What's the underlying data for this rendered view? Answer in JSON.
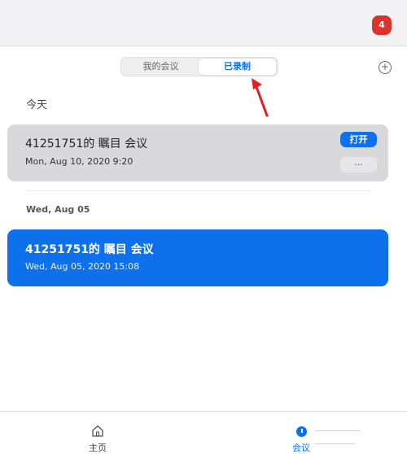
{
  "header": {
    "notification_count": "4"
  },
  "tabs": [
    {
      "label": "我的会议",
      "active": false
    },
    {
      "label": "已录制",
      "active": true
    }
  ],
  "add_button": {
    "icon": "plus-circle-icon",
    "glyph": "+"
  },
  "sections": [
    {
      "heading": "今天",
      "items": [
        {
          "title": "41251751的 瞩目 会议",
          "time": "Mon, Aug 10, 2020 9:20",
          "open_label": "打开",
          "more_label": "..."
        }
      ]
    },
    {
      "heading": "Wed, Aug 05",
      "items": [
        {
          "title": "41251751的 瞩目 会议",
          "time": "Wed, Aug 05, 2020 15:08",
          "selected": true
        }
      ]
    }
  ],
  "bottom_nav": {
    "home": {
      "label": "主页",
      "icon": "home-icon"
    },
    "meetings": {
      "label": "会议",
      "icon": "clock-icon",
      "active": true
    }
  },
  "colors": {
    "accent": "#0e71eb",
    "badge": "#d9332a",
    "arrow": "#e02020"
  }
}
